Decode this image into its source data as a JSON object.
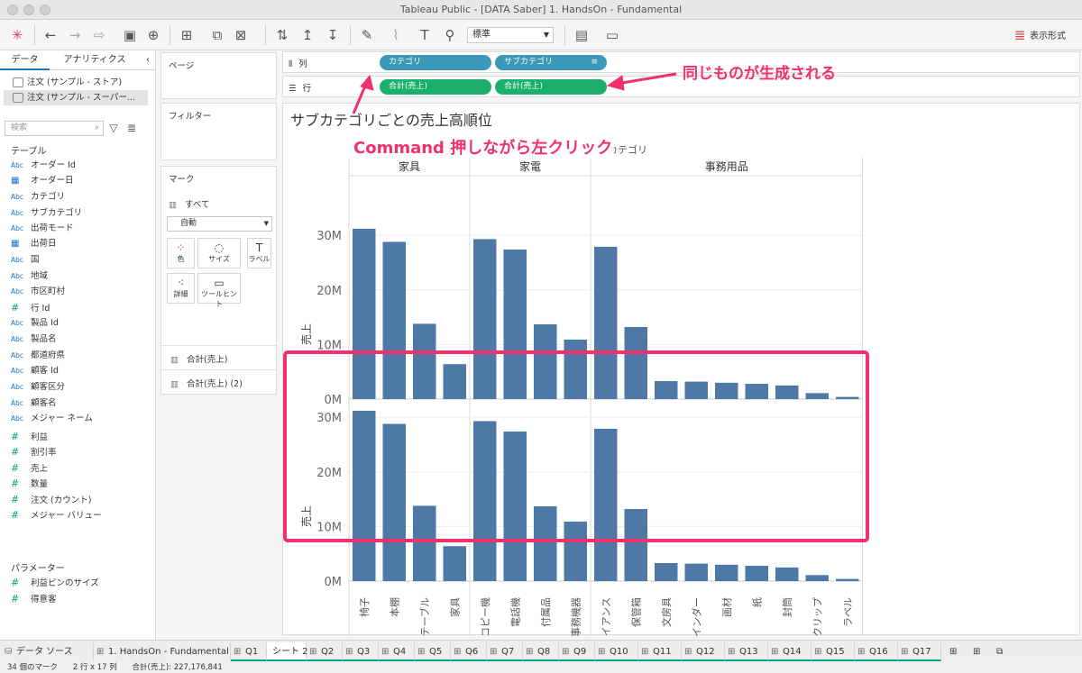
{
  "window": {
    "title": "Tableau Public - [DATA Saber] 1. HandsOn - Fundamental"
  },
  "toolbar": {
    "mark_size_select": "標準",
    "show_me_label": "表示形式"
  },
  "data_pane": {
    "tab_data": "データ",
    "tab_analytics": "アナリティクス",
    "sources": [
      "注文 (サンプル - ストア)",
      "注文 (サンプル - スーパー..."
    ],
    "search_placeholder": "検索",
    "tables_header": "テーブル",
    "fields": [
      {
        "type": "Abc",
        "name": "オーダー Id"
      },
      {
        "type": "date",
        "name": "オーダー日"
      },
      {
        "type": "Abc",
        "name": "カテゴリ"
      },
      {
        "type": "Abc",
        "name": "サブカテゴリ"
      },
      {
        "type": "Abc",
        "name": "出荷モード"
      },
      {
        "type": "date",
        "name": "出荷日"
      },
      {
        "type": "Abc",
        "name": "国"
      },
      {
        "type": "Abc",
        "name": "地域"
      },
      {
        "type": "Abc",
        "name": "市区町村"
      },
      {
        "type": "#",
        "name": "行 Id"
      },
      {
        "type": "Abc",
        "name": "製品 Id"
      },
      {
        "type": "Abc",
        "name": "製品名"
      },
      {
        "type": "Abc",
        "name": "都道府県"
      },
      {
        "type": "Abc",
        "name": "顧客 Id"
      },
      {
        "type": "Abc",
        "name": "顧客区分"
      },
      {
        "type": "Abc",
        "name": "顧客名"
      },
      {
        "type": "Abc",
        "name": "メジャー ネーム"
      },
      {
        "type": "#",
        "name": "利益"
      },
      {
        "type": "#",
        "name": "割引率"
      },
      {
        "type": "#",
        "name": "売上"
      },
      {
        "type": "#",
        "name": "数量"
      },
      {
        "type": "#",
        "name": "注文 (カウント)"
      },
      {
        "type": "#",
        "name": "メジャー バリュー"
      }
    ],
    "parameters_header": "パラメーター",
    "parameters": [
      {
        "type": "#",
        "name": "利益ビンのサイズ"
      },
      {
        "type": "#",
        "name": "得意客"
      }
    ]
  },
  "shelves": {
    "pages_label": "ページ",
    "filters_label": "フィルター",
    "marks_label": "マーク",
    "marks_all": "すべて",
    "mark_type": "自動",
    "mark_buttons": [
      "色",
      "サイズ",
      "ラベル",
      "詳細",
      "ツールヒント"
    ],
    "mark_measures": [
      "合計(売上)",
      "合計(売上) (2)"
    ],
    "columns_label": "列",
    "rows_label": "行",
    "column_pills": [
      "カテゴリ",
      "サブカテゴリ"
    ],
    "row_pills": [
      "合計(売上)",
      "合計(売上)"
    ]
  },
  "view": {
    "title": "サブカテゴリごとの売上高順位"
  },
  "annotations": {
    "same_generated": "同じものが生成される",
    "command_click": "Command 押しながら左クリック"
  },
  "chart_data": {
    "type": "bar",
    "header_label": "カテゴリ",
    "groups": [
      {
        "category": "家具",
        "subcategories": [
          "椅子",
          "本棚",
          "テーブル",
          "家具"
        ]
      },
      {
        "category": "家電",
        "subcategories": [
          "コピー機",
          "電話機",
          "付属品",
          "事務機器"
        ]
      },
      {
        "category": "事務用品",
        "subcategories": [
          "アプライアンス",
          "保管箱",
          "文房具",
          "バインダー",
          "画材",
          "紙",
          "封筒",
          "クリップ",
          "ラベル"
        ]
      }
    ],
    "categories": [
      "椅子",
      "本棚",
      "テーブル",
      "家具",
      "コピー機",
      "電話機",
      "付属品",
      "事務機器",
      "アプライアンス",
      "保管箱",
      "文房具",
      "バインダー",
      "画材",
      "紙",
      "封筒",
      "クリップ",
      "ラベル"
    ],
    "series": [
      {
        "name": "合計(売上)",
        "values": [
          31.2,
          28.8,
          13.8,
          6.4,
          29.3,
          27.4,
          13.7,
          10.9,
          27.9,
          13.2,
          3.3,
          3.2,
          3.0,
          2.8,
          2.5,
          1.1,
          0.4
        ]
      },
      {
        "name": "合計(売上) (2)",
        "values": [
          31.2,
          28.8,
          13.8,
          6.4,
          29.3,
          27.4,
          13.7,
          10.9,
          27.9,
          13.2,
          3.3,
          3.2,
          3.0,
          2.8,
          2.5,
          1.1,
          0.4
        ]
      }
    ],
    "unit": "M",
    "ylabel": "売上",
    "yticks": [
      "0M",
      "10M",
      "20M",
      "30M"
    ],
    "ylim": [
      0,
      33
    ]
  },
  "sheet_tabs": [
    "データ ソース",
    "1. HandsOn - Fundamental",
    "Q1",
    "シート 2",
    "Q2",
    "Q3",
    "Q4",
    "Q5",
    "Q6",
    "Q7",
    "Q8",
    "Q9",
    "Q10",
    "Q11",
    "Q12",
    "Q13",
    "Q14",
    "Q15",
    "Q16",
    "Q17"
  ],
  "status": {
    "marks": "34 個のマーク",
    "dims": "2 行 x 17 列",
    "sum": "合計(売上): 227,176,841"
  }
}
